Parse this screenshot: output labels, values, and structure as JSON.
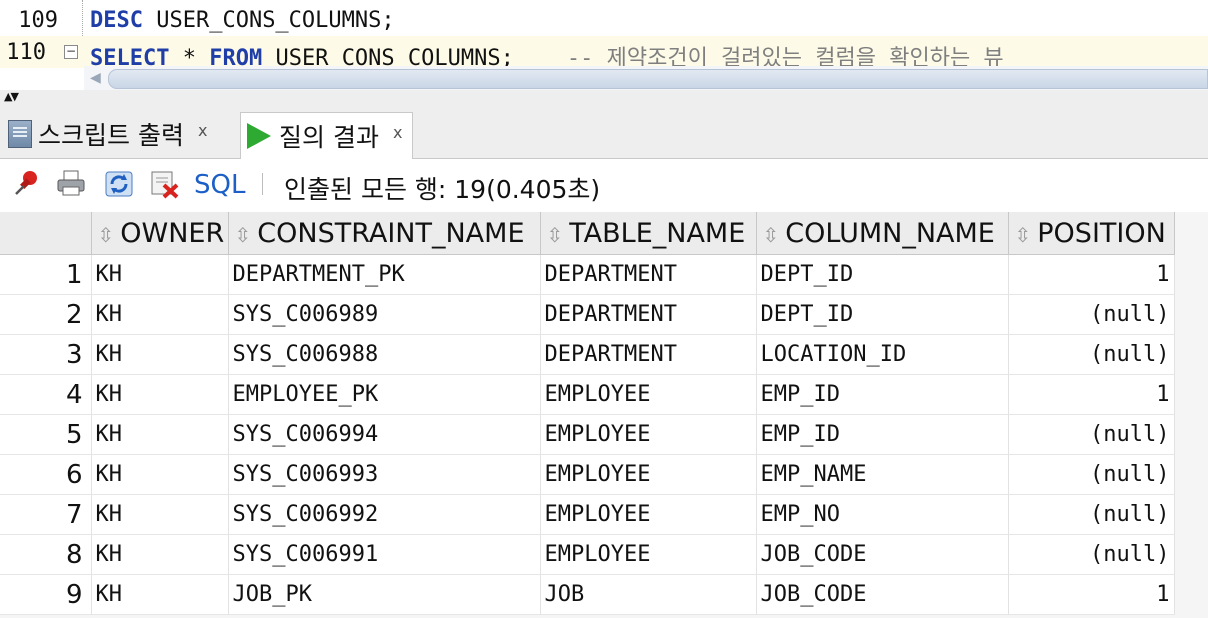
{
  "editor": {
    "lines": [
      {
        "num": "109",
        "keyword": "DESC",
        "rest": " USER_CONS_COLUMNS;"
      },
      {
        "num": "110",
        "keyword": "SELECT",
        "star": "*",
        "from": "FROM",
        "table": " USER_CONS_COLUMNS;",
        "comment": "-- 제약조건이 걸려있는 컬럼을 확인하는 뷰"
      }
    ]
  },
  "tabs": [
    {
      "label": "스크립트 출력",
      "close": "x",
      "active": false
    },
    {
      "label": "질의 결과",
      "close": "x",
      "active": true
    }
  ],
  "toolbar": {
    "sql_label": "SQL",
    "status": "인출된 모든 행: 19(0.405초)"
  },
  "grid": {
    "columns": [
      "OWNER",
      "CONSTRAINT_NAME",
      "TABLE_NAME",
      "COLUMN_NAME",
      "POSITION"
    ],
    "sort_icon": "⇳",
    "rows": [
      [
        "1",
        "KH",
        "DEPARTMENT_PK",
        "DEPARTMENT",
        "DEPT_ID",
        "1"
      ],
      [
        "2",
        "KH",
        "SYS_C006989",
        "DEPARTMENT",
        "DEPT_ID",
        "(null)"
      ],
      [
        "3",
        "KH",
        "SYS_C006988",
        "DEPARTMENT",
        "LOCATION_ID",
        "(null)"
      ],
      [
        "4",
        "KH",
        "EMPLOYEE_PK",
        "EMPLOYEE",
        "EMP_ID",
        "1"
      ],
      [
        "5",
        "KH",
        "SYS_C006994",
        "EMPLOYEE",
        "EMP_ID",
        "(null)"
      ],
      [
        "6",
        "KH",
        "SYS_C006993",
        "EMPLOYEE",
        "EMP_NAME",
        "(null)"
      ],
      [
        "7",
        "KH",
        "SYS_C006992",
        "EMPLOYEE",
        "EMP_NO",
        "(null)"
      ],
      [
        "8",
        "KH",
        "SYS_C006991",
        "EMPLOYEE",
        "JOB_CODE",
        "(null)"
      ],
      [
        "9",
        "KH",
        "JOB_PK",
        "JOB",
        "JOB_CODE",
        "1"
      ]
    ]
  },
  "icons": [
    "pin-icon",
    "print-icon",
    "refresh-icon",
    "delete-icon",
    "script-output-icon",
    "run-icon",
    "fold-icon",
    "splitter-arrows-icon",
    "scroll-left-icon"
  ]
}
